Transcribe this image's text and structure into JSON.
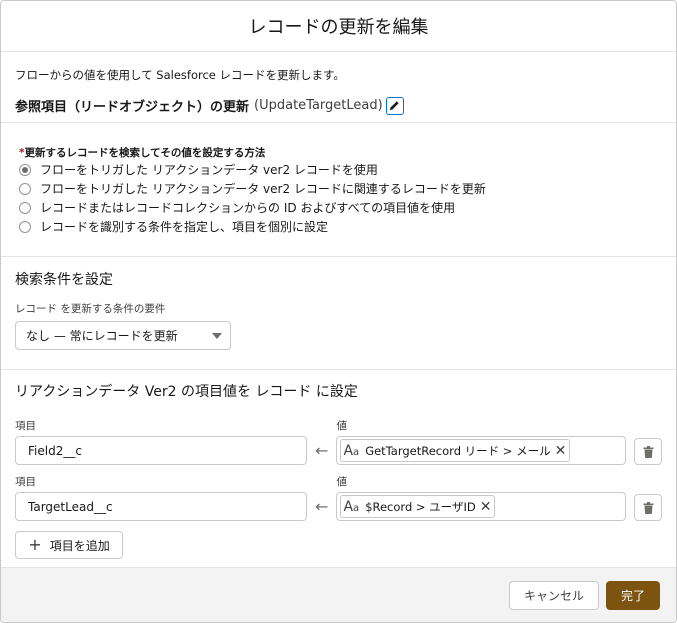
{
  "modal": {
    "title": "レコードの更新を編集"
  },
  "intro": {
    "description": "フローからの値を使用して Salesforce レコードを更新します。",
    "element_label": "参照項目（リードオブジェクト）の更新",
    "element_api_name": "(UpdateTargetLead)"
  },
  "method": {
    "required_mark": "*",
    "label": "更新するレコードを検索してその値を設定する方法",
    "options": [
      {
        "label": "フローをトリガした リアクションデータ ver2 レコードを使用",
        "selected": true
      },
      {
        "label": "フローをトリガした リアクションデータ ver2 レコードに関連するレコードを更新",
        "selected": false
      },
      {
        "label": "レコードまたはレコードコレクションからの ID およびすべての項目値を使用",
        "selected": false
      },
      {
        "label": "レコードを識別する条件を指定し、項目を個別に設定",
        "selected": false
      }
    ]
  },
  "filter": {
    "title": "検索条件を設定",
    "condition_label": "レコード を更新する条件の要件",
    "condition_value": "なし — 常にレコードを更新"
  },
  "assignments": {
    "title": "リアクションデータ Ver2 の項目値を レコード に設定",
    "field_label": "項目",
    "value_label": "値",
    "rows": [
      {
        "field": "Field2__c",
        "value_icon": "Aa",
        "value": "GetTargetRecord リード > メール"
      },
      {
        "field": "TargetLead__c",
        "value_icon": "Aa",
        "value": "$Record > ユーザID"
      }
    ],
    "add_button": "項目を追加"
  },
  "footer": {
    "cancel": "キャンセル",
    "done": "完了"
  },
  "colors": {
    "brand_button": "#7c5410",
    "accent_blue": "#0176d3",
    "required": "#ba0517"
  }
}
